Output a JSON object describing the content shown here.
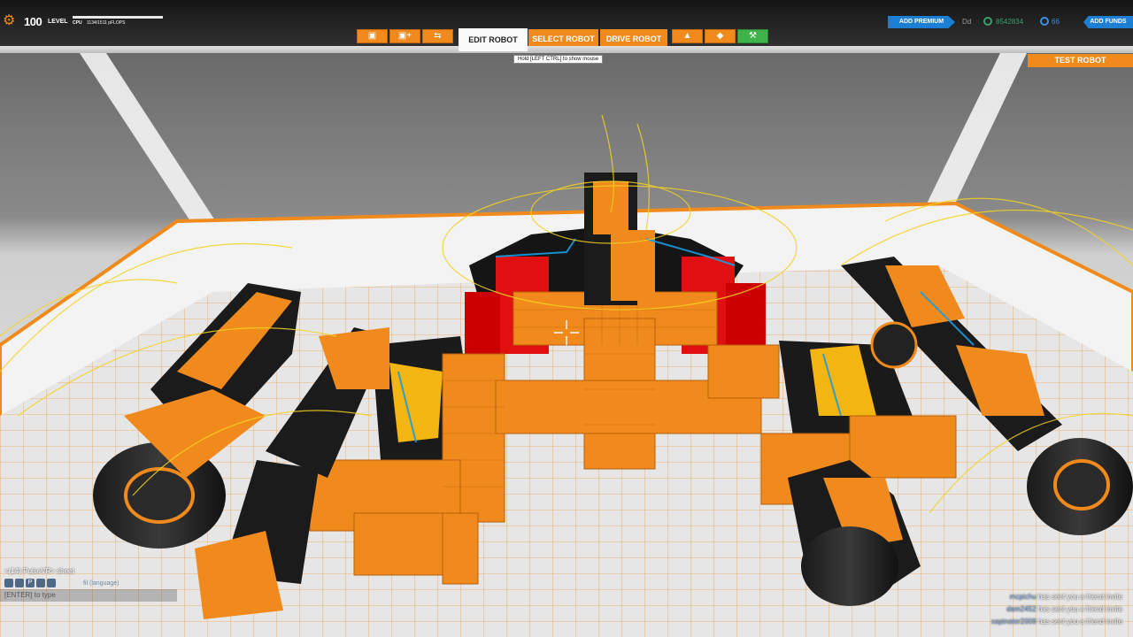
{
  "header": {
    "level_number": "100",
    "level_word": "LEVEL",
    "cpu_label": "CPU",
    "cpu_value": "1134/1511 pFLOPS",
    "tabs": {
      "edit": "EDIT ROBOT",
      "select": "SELECT ROBOT",
      "drive": "DRIVE ROBOT"
    },
    "hint": "Hold [LEFT CTRL] to show mouse",
    "add_premium": "ADD PREMIUM",
    "username": "Dd",
    "robits": "8542834",
    "galaxy_credits": "66",
    "add_funds": "ADD FUNDS"
  },
  "test_robot_label": "TEST ROBOT",
  "chat": {
    "message": "<(14) PulseVR> sheet",
    "tool_labels": [
      "",
      "",
      "P",
      "",
      ""
    ],
    "language_hint": "fil (language)",
    "input_placeholder": "[ENTER] to type"
  },
  "notifications": [
    {
      "name": "mcpichu",
      "text": "has sent you a friend invite"
    },
    {
      "name": "dam2452",
      "text": "has sent you a friend invite"
    },
    {
      "name": "xapinator2009",
      "text": "has sent you a friend invite"
    }
  ],
  "colors": {
    "accent": "#f08a1c",
    "premium_blue": "#1c7fd4",
    "robits_green": "#39a06c",
    "gc_blue": "#3f8fe0",
    "weapon_red": "#e01010"
  },
  "icons": [
    "gear-icon",
    "cube-icon",
    "add-cube-icon",
    "link-icon",
    "avatar-icon",
    "shield-icon",
    "forge-icon",
    "robits-icon",
    "galaxy-credits-icon"
  ]
}
